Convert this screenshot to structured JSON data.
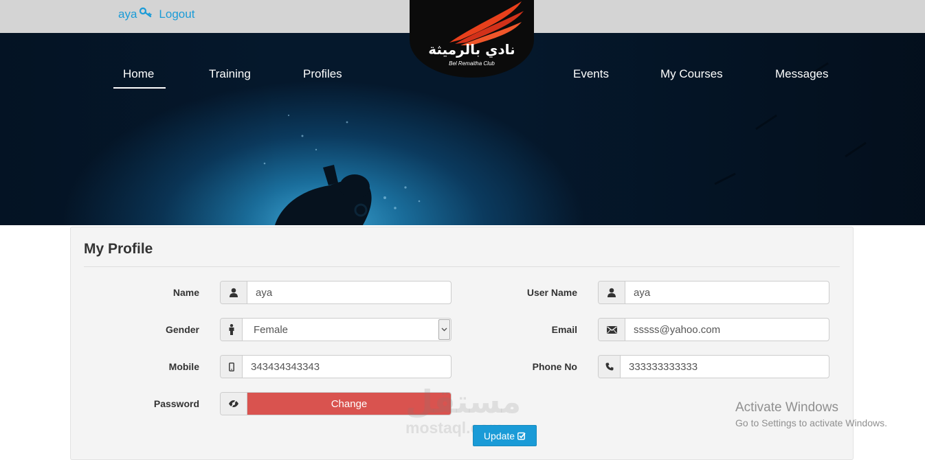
{
  "topbar": {
    "username": "aya",
    "logout_label": "Logout",
    "link_color": "#1a9bd7",
    "key_icon": "key-icon"
  },
  "logo": {
    "arabic_name": "نادي بالرميثة",
    "english_name": "Bel Remaitha Club",
    "accent_color": "#e8401c"
  },
  "nav": {
    "left": [
      "Home",
      "Training",
      "Profiles"
    ],
    "right": [
      "Events",
      "My Courses",
      "Messages"
    ],
    "active": "Home"
  },
  "profile": {
    "title": "My Profile",
    "name": {
      "label": "Name",
      "value": "aya",
      "icon": "user-icon"
    },
    "gender": {
      "label": "Gender",
      "value": "Female",
      "icon": "person-icon"
    },
    "mobile": {
      "label": "Mobile",
      "value": "343434343343",
      "icon": "mobile-icon"
    },
    "password": {
      "label": "Password",
      "button": "Change",
      "icon": "eye-slash-icon"
    },
    "username": {
      "label": "User Name",
      "value": "aya",
      "icon": "user-icon"
    },
    "email": {
      "label": "Email",
      "value": "sssss@yahoo.com",
      "icon": "envelope-icon"
    },
    "phone": {
      "label": "Phone No",
      "value": "333333333333",
      "icon": "phone-icon"
    },
    "update_button": "Update",
    "danger_color": "#d9534f",
    "primary_color": "#1a9bd7"
  },
  "watermark": {
    "arabic": "مستقل",
    "latin": "mostaql.com"
  },
  "os_notice": {
    "title": "Activate Windows",
    "subtitle": "Go to Settings to activate Windows."
  }
}
